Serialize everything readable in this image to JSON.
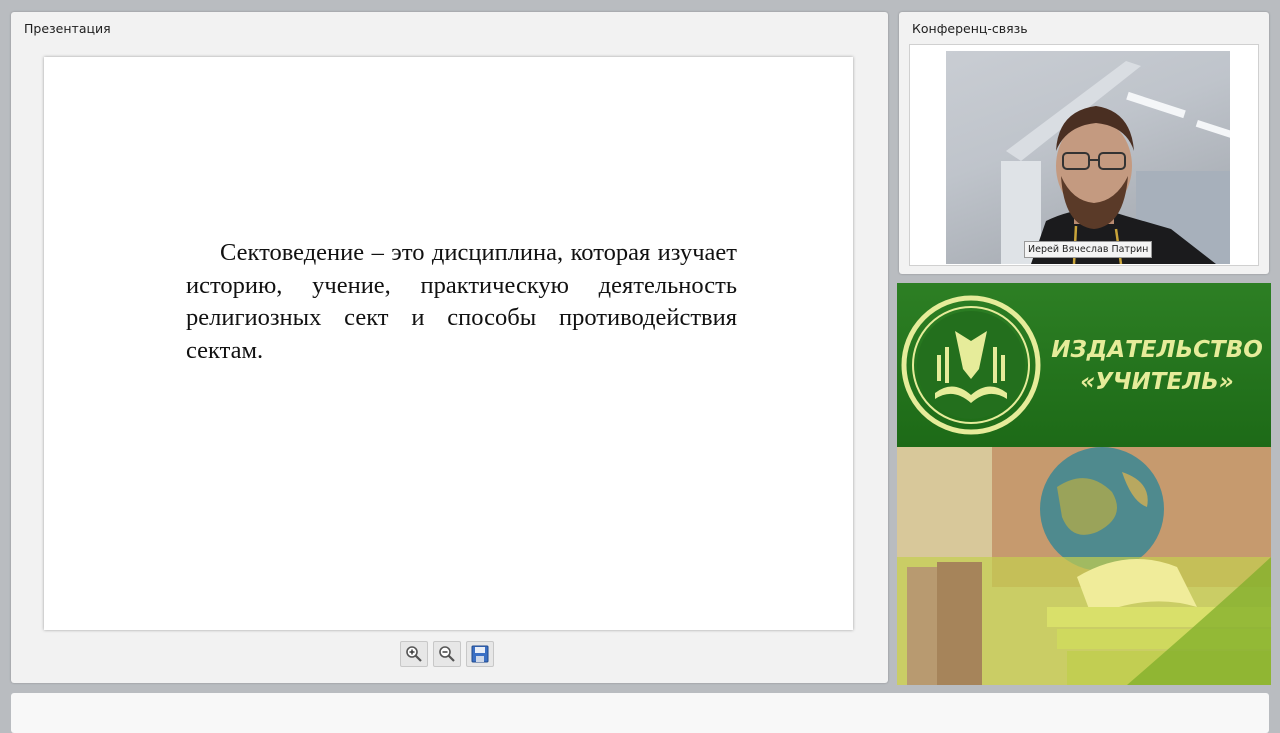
{
  "presentation": {
    "title": "Презентация",
    "slide_text": "Сектоведение – это дисциплина, которая изучает историю, учение, практическую деятельность религиозных сект и способы противодействия сектам.",
    "toolbar": {
      "zoom_in_icon": "zoom-in-icon",
      "zoom_out_icon": "zoom-out-icon",
      "save_icon": "save-icon"
    }
  },
  "conference": {
    "title": "Конференц-связь",
    "participant_name": "Иерей Вячеслав Патрин"
  },
  "publisher": {
    "name_line1": "ИЗДАТЕЛЬСТВО",
    "name_line2": "«УЧИТЕЛЬ»",
    "colors": {
      "banner_green": "#1f6b1a",
      "logo_yellow": "#e6ec9a"
    }
  }
}
